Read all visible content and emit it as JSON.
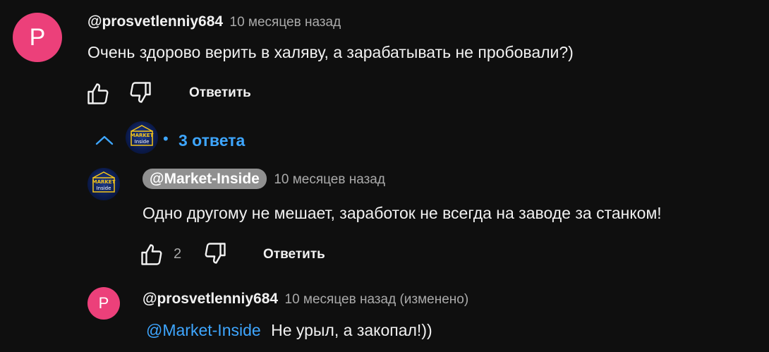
{
  "comment1": {
    "avatar_letter": "P",
    "author": "@prosvetlenniy684",
    "time": "10 месяцев назад",
    "text": "Очень здорово верить в халяву, а зарабатывать не пробовали?)",
    "reply_label": "Ответить"
  },
  "replies_toggle": {
    "label": "3 ответа",
    "dot": "•",
    "icon": "chevron-up-icon"
  },
  "reply1": {
    "author": "@Market-Inside",
    "time": "10 месяцев назад",
    "text": "Одно другому не мешает, заработок не всегда на заводе за станком!",
    "like_count": "2",
    "reply_label": "Ответить",
    "avatar_logo_top": "MARKET",
    "avatar_logo_bottom": "Inside"
  },
  "reply2": {
    "avatar_letter": "P",
    "author": "@prosvetlenniy684",
    "time": "10 месяцев назад (изменено)",
    "mention": "@Market-Inside",
    "text": "Не урыл, а закопал!))"
  },
  "colors": {
    "background": "#0f0f0f",
    "avatar_pink": "#ec407a",
    "link_blue": "#3ea6ff",
    "owner_chip": "#909090",
    "meta_gray": "#aaaaaa",
    "text": "#f1f1f1"
  }
}
